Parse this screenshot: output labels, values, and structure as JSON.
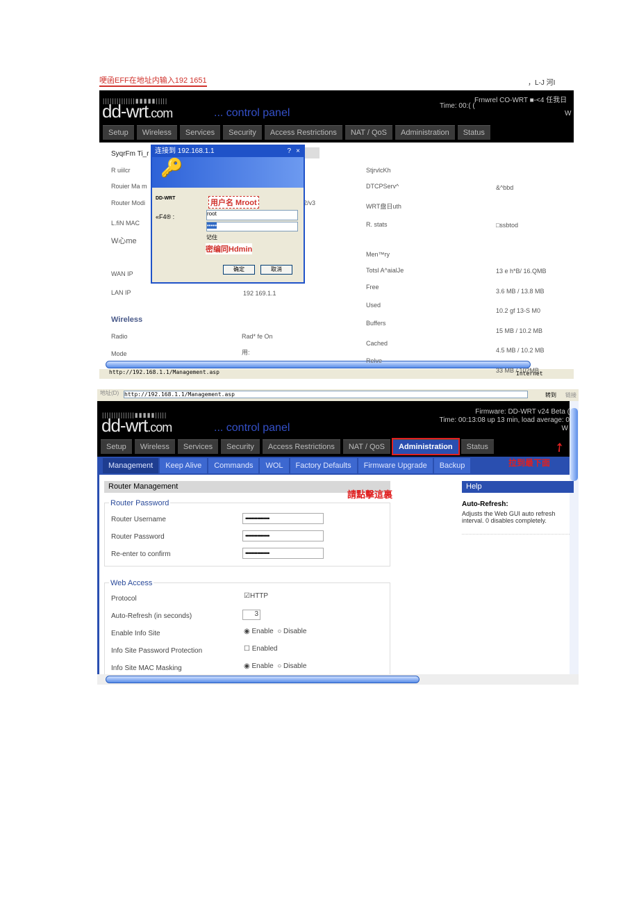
{
  "caption_top": "哽函EFF在地址内输入192  1651",
  "caption_top_right": "，L-J 河I",
  "shot1": {
    "firmware": "Frnwrel CO-WRT ■-<4 任我日",
    "time": "Time: 00:( (",
    "w": "W",
    "logo": "dd-wrt",
    "logo_suffix": ".com",
    "control_panel": "... control panel",
    "nav": [
      "Setup",
      "Wireless",
      "Services",
      "Security",
      "Access Restrictions",
      "NAT / QoS",
      "Administration",
      "Status"
    ],
    "left_labels": [
      "SyqrFm Ti_r",
      "R uiilcr",
      "Rouier Ma m",
      "Router Modi",
      "L.fiN MAC",
      "W心me",
      "WAN IP",
      "LAN IP"
    ],
    "lan_ip": "192 169.1.1",
    "v23": "2/v3",
    "wireless_heading": "Wireless",
    "radio_label": "Radio",
    "radio_value": "Rad* fe On",
    "mode_label": "Mode",
    "mode_value": "用:",
    "right_labels": [
      "StjrvlcKh",
      "DTCPServ^",
      "WRT盘日uth",
      "R. stats",
      "Men™ry",
      "Totsl A^aialJe",
      "Free",
      "Used",
      "Buffers",
      "Cached",
      "Relve"
    ],
    "right_values": [
      "&^bbd",
      "□ssbtod",
      "13 e h*B/ 16.QMB",
      "3.6 MB / 13.8 MB",
      "10.2 gf 13-S M0",
      "15 MB / 10.2 MB",
      "4.5 MB / 10.2 MB",
      "33 MB / 102MB"
    ],
    "dialog": {
      "title": "连接到 192.168.1.1",
      "help": "?",
      "close": "×",
      "realm": "DD-WRT",
      "user_label": "«F4® :",
      "user_value": "root",
      "password_value": "•••••",
      "remember": "记住",
      "ok": "确定",
      "cancel": "取消"
    },
    "annot_user": "用户名 Mroot",
    "annot_pass": "密编同Hdmin",
    "status_url": "http://192.168.1.1/Management.asp",
    "status_zone": "Internet"
  },
  "shot2": {
    "address_label": "地址(D)",
    "url": "http://192.168.1.1/Management.asp",
    "go": "转到",
    "links": "链接",
    "firmware": "Firmware: DD-WRT v24 Beta (",
    "time": "Time: 00:13:08 up 13 min, load average: 0",
    "w": "W",
    "logo": "dd-wrt",
    "logo_suffix": ".com",
    "control_panel": "... control panel",
    "nav": [
      "Setup",
      "Wireless",
      "Services",
      "Security",
      "Access Restrictions",
      "NAT / QoS",
      "Administration",
      "Status"
    ],
    "subnav": [
      "Management",
      "Keep Alive",
      "Commands",
      "WOL",
      "Factory Defaults",
      "Firmware Upgrade",
      "Backup"
    ],
    "annot_scroll": "拉到最下面",
    "annot_click": "請點擊這裏",
    "page_title": "Router Management",
    "router_password": {
      "legend": "Router Password",
      "username_label": "Router Username",
      "password_label": "Router Password",
      "confirm_label": "Re-enter to confirm",
      "masked": "••••••••••••••••"
    },
    "web_access": {
      "legend": "Web Access",
      "protocol_label": "Protocol",
      "protocol_value": "HTTP",
      "autorefresh_label": "Auto-Refresh (in seconds)",
      "autorefresh_value": "3",
      "info_site_label": "Enable Info Site",
      "info_pw_label": "Info Site Password Protection",
      "info_pw_value": "Enabled",
      "mac_label": "Info Site MAC Masking",
      "enable": "Enable",
      "disable": "Disable"
    },
    "help": {
      "title": "Help",
      "heading": "Auto-Refresh:",
      "text": "Adjusts the Web GUI auto refresh interval. 0 disables completely."
    }
  },
  "colors": {
    "accent": "#2a4fb0",
    "annotation": "#d0302a"
  }
}
